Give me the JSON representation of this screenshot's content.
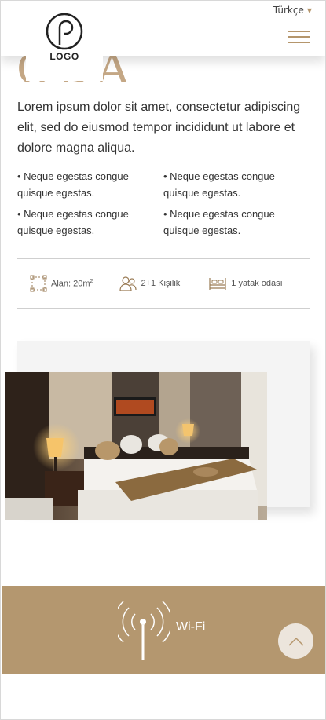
{
  "header": {
    "logo_text": "LOGO",
    "language": "Türkçe",
    "language_chevron": "chevron-down-icon",
    "menu_icon": "hamburger-icon"
  },
  "heading_fragment": "ODA",
  "intro": "Lorem ipsum dolor sit amet, consectetur adipiscing elit, sed do eiusmod tempor incididunt ut labore et dolore magna aliqua.",
  "features": [
    "• Neque egestas congue quisque egestas.",
    "• Neque egestas congue quisque egestas.",
    "• Neque egestas congue quisque egestas.",
    "• Neque egestas congue quisque egestas."
  ],
  "specs": {
    "area_label": "Alan: 20m",
    "area_unit_sup": "2",
    "capacity": "2+1 Kişilik",
    "bedroom": "1 yatak odası"
  },
  "amenity": {
    "label": "Wi-Fi",
    "icon": "wifi-antenna-icon"
  },
  "colors": {
    "accent": "#b5966c",
    "band": "#b4976f",
    "heading": "#c4a785"
  }
}
